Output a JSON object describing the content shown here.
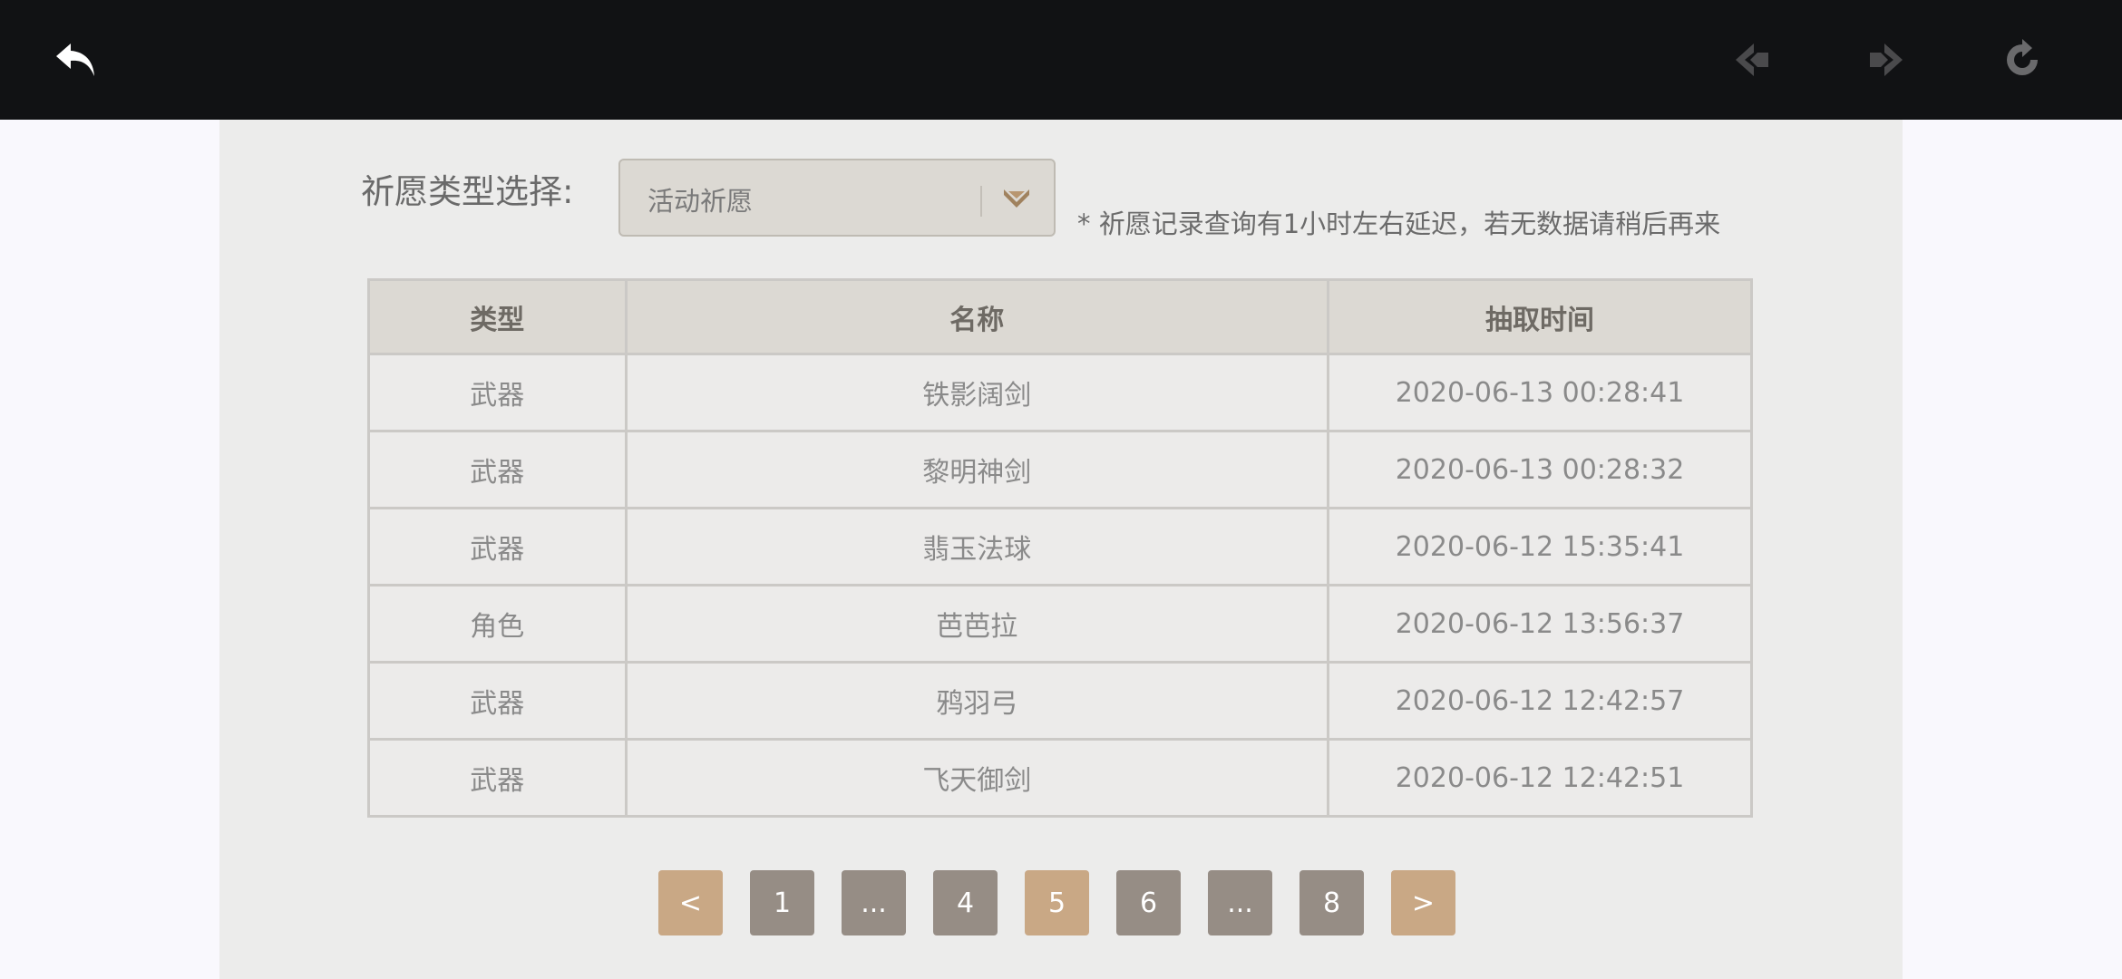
{
  "toolbar": {
    "back_icon": "back-arrow-icon",
    "prev_icon": "nav-back-icon",
    "next_icon": "nav-forward-icon",
    "reload_icon": "reload-icon"
  },
  "filter": {
    "label": "祈愿类型选择:",
    "selected": "活动祈愿",
    "note": "* 祈愿记录查询有1小时左右延迟，若无数据请稍后再来"
  },
  "table": {
    "headers": {
      "type": "类型",
      "name": "名称",
      "time": "抽取时间"
    },
    "rows": [
      {
        "type": "武器",
        "name": "铁影阔剑",
        "time": "2020-06-13 00:28:41"
      },
      {
        "type": "武器",
        "name": "黎明神剑",
        "time": "2020-06-13 00:28:32"
      },
      {
        "type": "武器",
        "name": "翡玉法球",
        "time": "2020-06-12 15:35:41"
      },
      {
        "type": "角色",
        "name": "芭芭拉",
        "time": "2020-06-12 13:56:37"
      },
      {
        "type": "武器",
        "name": "鸦羽弓",
        "time": "2020-06-12 12:42:57"
      },
      {
        "type": "武器",
        "name": "飞天御剑",
        "time": "2020-06-12 12:42:51"
      }
    ]
  },
  "pager": {
    "prev": "<",
    "pages": [
      "1",
      "...",
      "4",
      "5",
      "6",
      "...",
      "8"
    ],
    "next": ">",
    "current": "5"
  },
  "colors": {
    "topbar": "#111214",
    "panel": "#ececeb",
    "accent": "#c9a885",
    "page_button": "#968d85"
  }
}
